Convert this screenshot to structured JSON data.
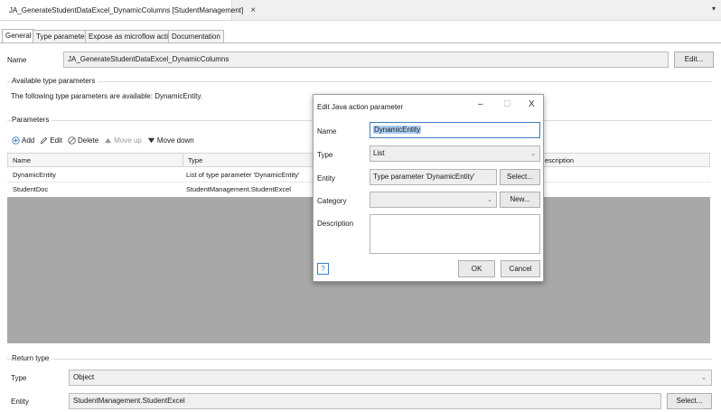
{
  "doc_tab": {
    "title": "JA_GenerateStudentDataExcel_DynamicColumns [StudentManagement]",
    "close": "×",
    "menu": "▾"
  },
  "tabs": [
    "General",
    "Type parameters",
    "Expose as microflow action",
    "Documentation"
  ],
  "name_row": {
    "label": "Name",
    "value": "JA_GenerateStudentDataExcel_DynamicColumns",
    "edit_button": "Edit..."
  },
  "available_type_parameters": {
    "group_label": "Available type parameters",
    "text": "The following type parameters are available: DynamicEntity."
  },
  "parameters": {
    "group_label": "Parameters",
    "toolbar": {
      "add": "Add",
      "edit": "Edit",
      "delete": "Delete",
      "move_up": "Move up",
      "move_down": "Move down"
    },
    "columns": [
      "Name",
      "Type",
      "escription"
    ],
    "rows": [
      {
        "name": "DynamicEntity",
        "type": "List of type parameter 'DynamicEntity'"
      },
      {
        "name": "StudentDoc",
        "type": "StudentManagement.StudentExcel"
      }
    ]
  },
  "return_type": {
    "group_label": "Return type",
    "type_label": "Type",
    "type_value": "Object",
    "entity_label": "Entity",
    "entity_value": "StudentManagement.StudentExcel",
    "select_button": "Select..."
  },
  "dialog": {
    "title": "Edit Java action parameter",
    "minimize": "–",
    "maximize": "☐",
    "close": "X",
    "name_label": "Name",
    "name_value": "DynamicEntity",
    "type_label": "Type",
    "type_value": "List",
    "entity_label": "Entity",
    "entity_value": "Type parameter 'DynamicEntity'",
    "entity_select": "Select...",
    "category_label": "Category",
    "category_value": "",
    "category_new": "New...",
    "description_label": "Description",
    "description_value": "",
    "help": "?",
    "ok": "OK",
    "cancel": "Cancel"
  },
  "colors": {
    "accent": "#3b7fc4",
    "selection": "#aacdf3",
    "grid_empty": "#a8a8a8",
    "add_icon": "#3b7fc4"
  },
  "icons": [
    "java-action-icon",
    "add-icon",
    "edit-icon",
    "delete-icon",
    "move-up-icon",
    "move-down-icon",
    "help-icon",
    "chevron-down-icon"
  ]
}
